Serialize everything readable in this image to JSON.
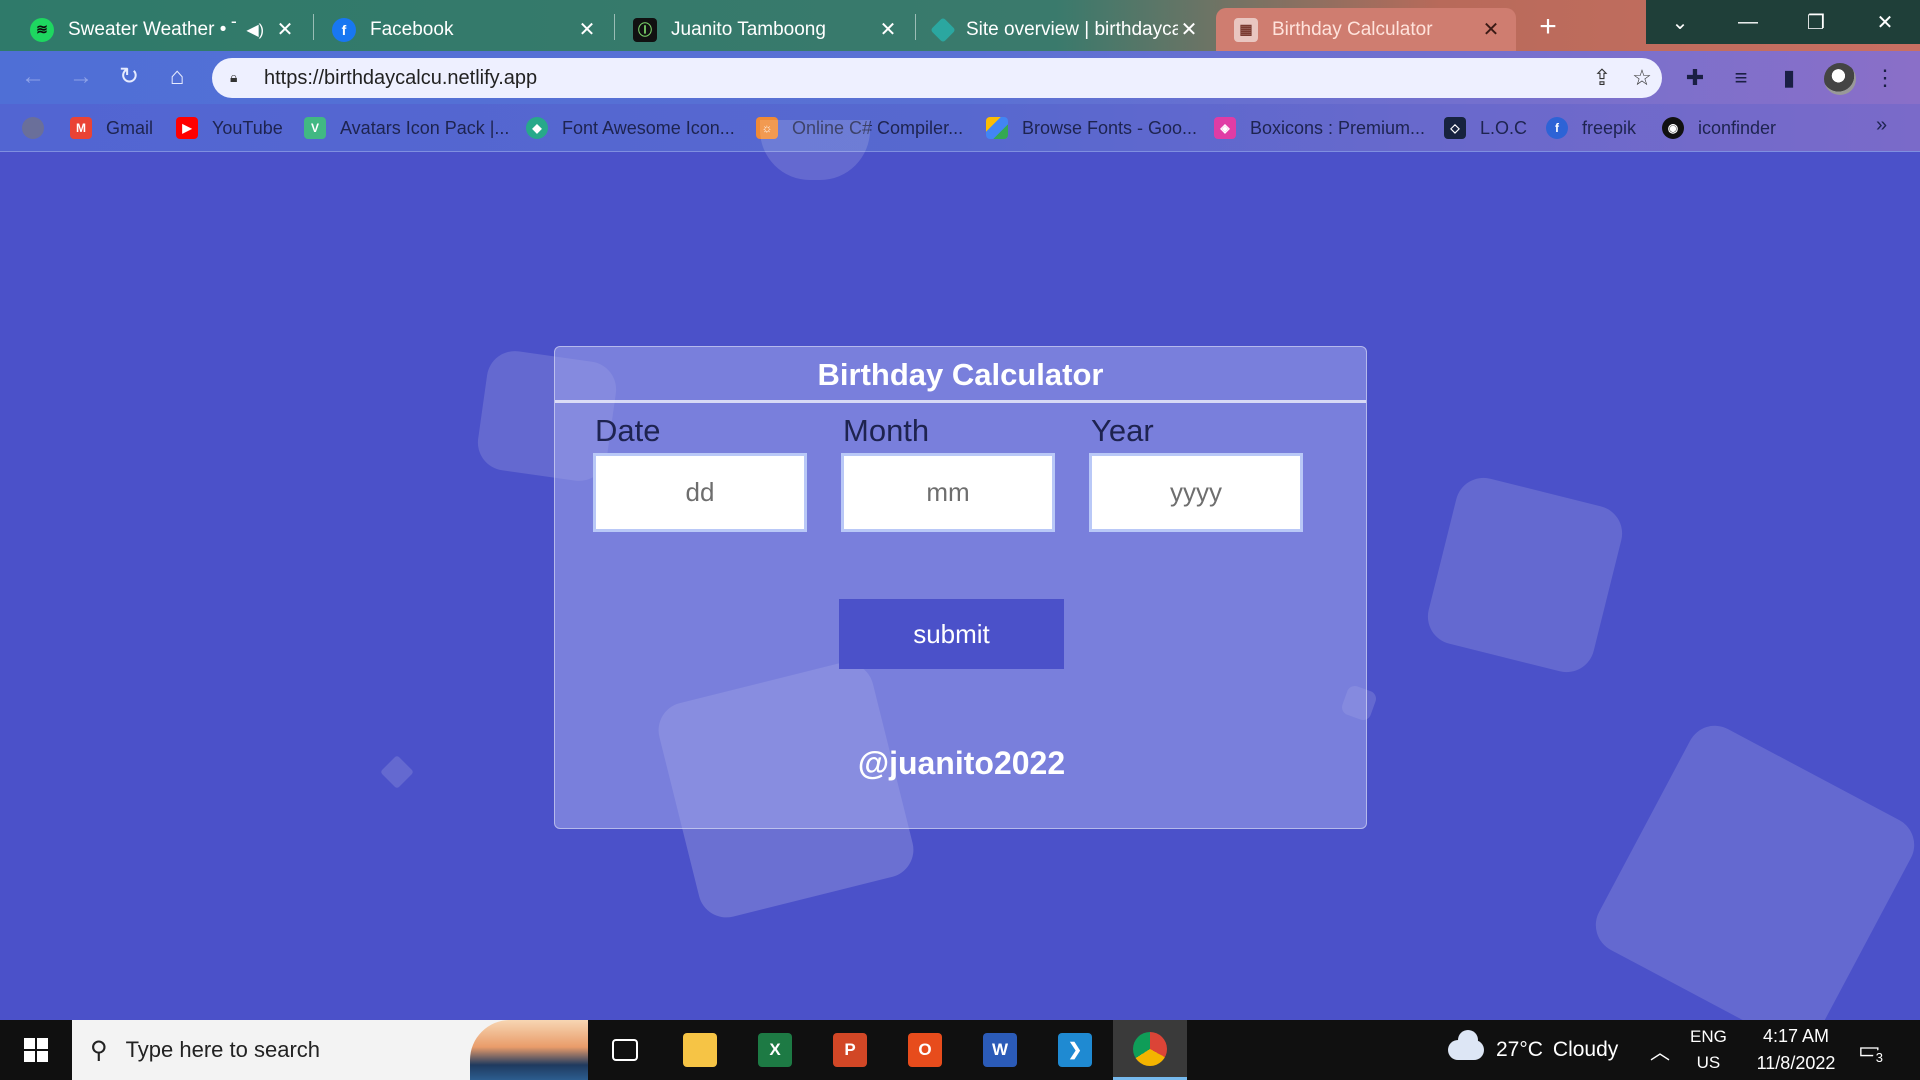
{
  "browser": {
    "tabs": [
      {
        "title": "Sweater Weather • Th",
        "favicon": "spotify-icon",
        "audio": true
      },
      {
        "title": "Facebook",
        "favicon": "facebook-icon"
      },
      {
        "title": "Juanito Tamboong",
        "favicon": "site-icon"
      },
      {
        "title": "Site overview | birthdayca",
        "favicon": "netlify-icon"
      },
      {
        "title": "Birthday Calculator",
        "favicon": "calendar-icon",
        "active": true
      }
    ],
    "url": "https://birthdaycalcu.netlify.app",
    "bookmarks": [
      {
        "label": "Gmail",
        "icon": "gmail-icon"
      },
      {
        "label": "YouTube",
        "icon": "youtube-icon"
      },
      {
        "label": "Avatars Icon Pack |...",
        "icon": "vue-icon"
      },
      {
        "label": "Font Awesome Icon...",
        "icon": "font-awesome-icon"
      },
      {
        "label": "Online C# Compiler...",
        "icon": "compiler-icon"
      },
      {
        "label": "Browse Fonts - Goo...",
        "icon": "google-fonts-icon"
      },
      {
        "label": "Boxicons : Premium...",
        "icon": "boxicons-icon"
      },
      {
        "label": "L.O.C",
        "icon": "loc-icon"
      },
      {
        "label": "freepik",
        "icon": "freepik-icon"
      },
      {
        "label": "iconfinder",
        "icon": "iconfinder-icon"
      }
    ]
  },
  "app": {
    "title": "Birthday Calculator",
    "fields": {
      "date": {
        "label": "Date",
        "placeholder": "dd",
        "value": ""
      },
      "month": {
        "label": "Month",
        "placeholder": "mm",
        "value": ""
      },
      "year": {
        "label": "Year",
        "placeholder": "yyyy",
        "value": ""
      }
    },
    "submit_label": "submit",
    "footer": "@juanito2022",
    "colors": {
      "background": "#4b51c9",
      "card": "#a0a6eb",
      "button": "#4b51c9"
    }
  },
  "taskbar": {
    "search_placeholder": "Type here to search",
    "weather": {
      "temp": "27°C",
      "condition": "Cloudy"
    },
    "language": {
      "lang": "ENG",
      "region": "US"
    },
    "time": "4:17 AM",
    "date": "11/8/2022",
    "notifications": "3"
  }
}
